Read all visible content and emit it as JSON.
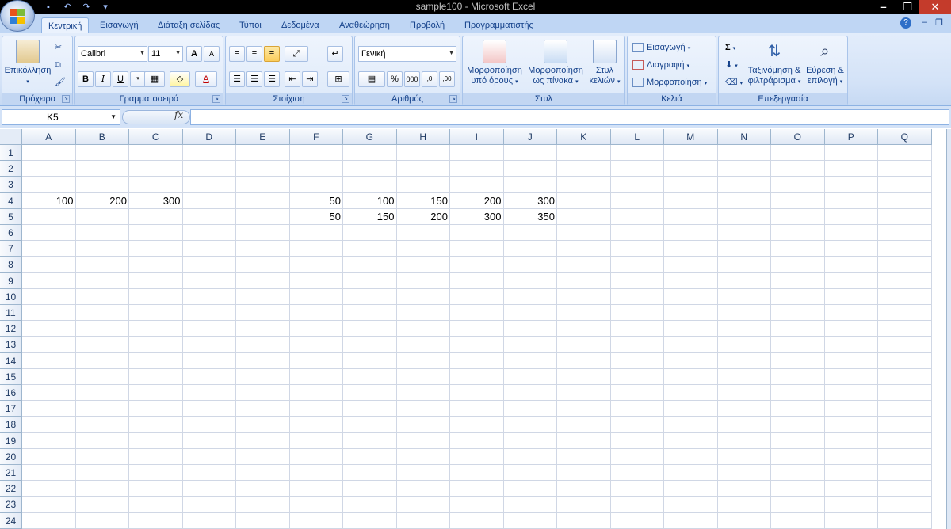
{
  "window": {
    "title": "sample100 - Microsoft Excel"
  },
  "qat": {
    "save_icon": "save-icon",
    "undo_icon": "undo-icon",
    "redo_icon": "redo-icon"
  },
  "tabs": [
    {
      "label": "Κεντρική",
      "active": true
    },
    {
      "label": "Εισαγωγή"
    },
    {
      "label": "Διάταξη σελίδας"
    },
    {
      "label": "Τύποι"
    },
    {
      "label": "Δεδομένα"
    },
    {
      "label": "Αναθεώρηση"
    },
    {
      "label": "Προβολή"
    },
    {
      "label": "Προγραμματιστής"
    }
  ],
  "ribbon": {
    "clipboard": {
      "label": "Πρόχειρο",
      "paste": "Επικόλληση"
    },
    "font": {
      "label": "Γραμματοσειρά",
      "name": "Calibri",
      "size": "11",
      "bold": "B",
      "italic": "I",
      "underline": "U",
      "grow": "A",
      "shrink": "A",
      "fontcolor": "A"
    },
    "alignment": {
      "label": "Στοίχιση"
    },
    "number": {
      "label": "Αριθμός",
      "format": "Γενική",
      "percent": "%",
      "thousands": "000",
      "inc_decimal": ",0",
      "dec_decimal": ",00"
    },
    "styles": {
      "label": "Στυλ",
      "cond_format": [
        "Μορφοποίηση",
        "υπό όρους"
      ],
      "table_format": [
        "Μορφοποίηση",
        "ως πίνακα"
      ],
      "cell_styles": [
        "Στυλ",
        "κελιών"
      ]
    },
    "cells": {
      "label": "Κελιά",
      "insert": "Εισαγωγή",
      "delete": "Διαγραφή",
      "format": "Μορφοποίηση"
    },
    "editing": {
      "label": "Επεξεργασία",
      "sum": "Σ",
      "sort": [
        "Ταξινόμηση &",
        "φιλτράρισμα"
      ],
      "find": [
        "Εύρεση &",
        "επιλογή"
      ]
    }
  },
  "formula_bar": {
    "name_box": "K5",
    "fx": "fx",
    "content": ""
  },
  "columns": [
    "A",
    "B",
    "C",
    "D",
    "E",
    "F",
    "G",
    "H",
    "I",
    "J",
    "K",
    "L",
    "M",
    "N",
    "O",
    "P",
    "Q"
  ],
  "rows": [
    "1",
    "2",
    "3",
    "4",
    "5",
    "6",
    "7",
    "8",
    "9",
    "10",
    "11",
    "12",
    "13",
    "14",
    "15",
    "16",
    "17",
    "18",
    "19",
    "20",
    "21",
    "22",
    "23",
    "24"
  ],
  "cells": {
    "A4": "100",
    "B4": "200",
    "C4": "300",
    "F4": "50",
    "G4": "100",
    "H4": "150",
    "I4": "200",
    "J4": "300",
    "F5": "50",
    "G5": "150",
    "H5": "200",
    "I5": "300",
    "J5": "350"
  }
}
